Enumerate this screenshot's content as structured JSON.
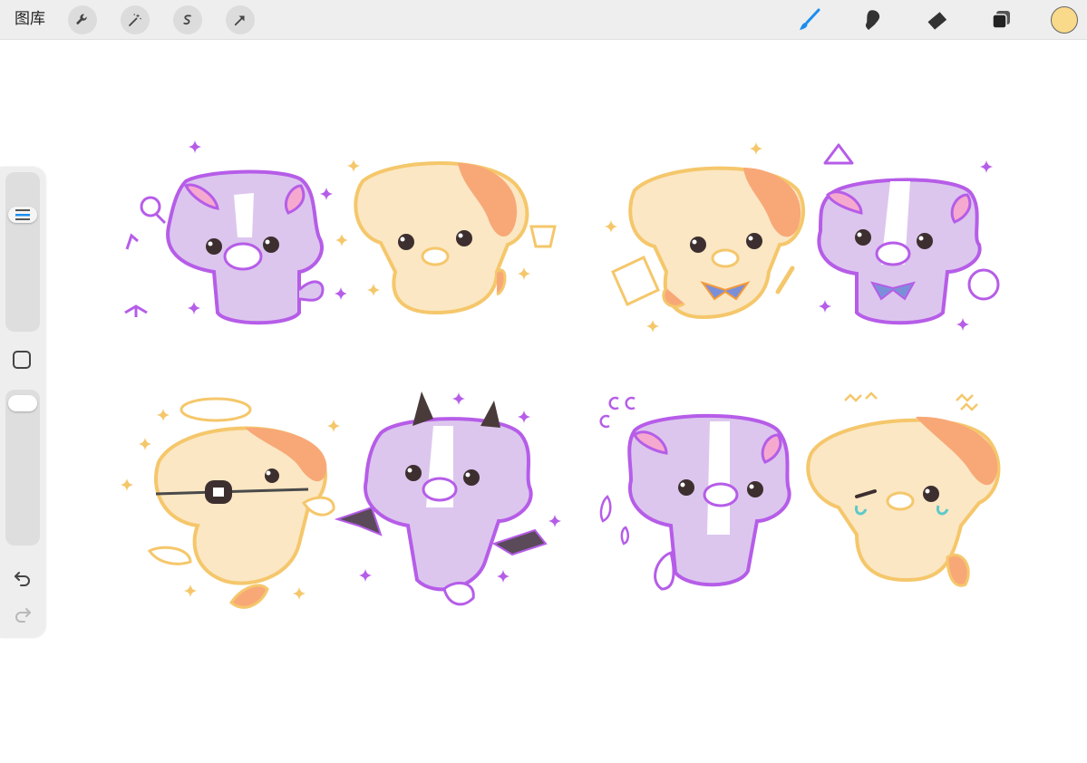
{
  "toolbar": {
    "gallery_label": "图库",
    "left_tools": [
      "wrench-icon",
      "magic-wand-icon",
      "selection-icon",
      "transform-arrow-icon"
    ],
    "right_tools": [
      "brush-icon",
      "smudge-icon",
      "eraser-icon",
      "layers-icon"
    ],
    "active_tool": "brush",
    "active_color": "#f9d98a",
    "accent_color": "#1a8df0"
  },
  "sidebar": {
    "brush_size": 0.78,
    "opacity": 1.0,
    "icons": [
      "modify-square-icon",
      "undo-icon",
      "redo-icon"
    ]
  },
  "canvas": {
    "palette": {
      "purple_outline": "#b65de8",
      "purple_fill": "#dcc6ee",
      "yellow_outline": "#f5c76b",
      "yellow_fill": "#fbe7c4",
      "orange_patch": "#f8a877"
    }
  }
}
